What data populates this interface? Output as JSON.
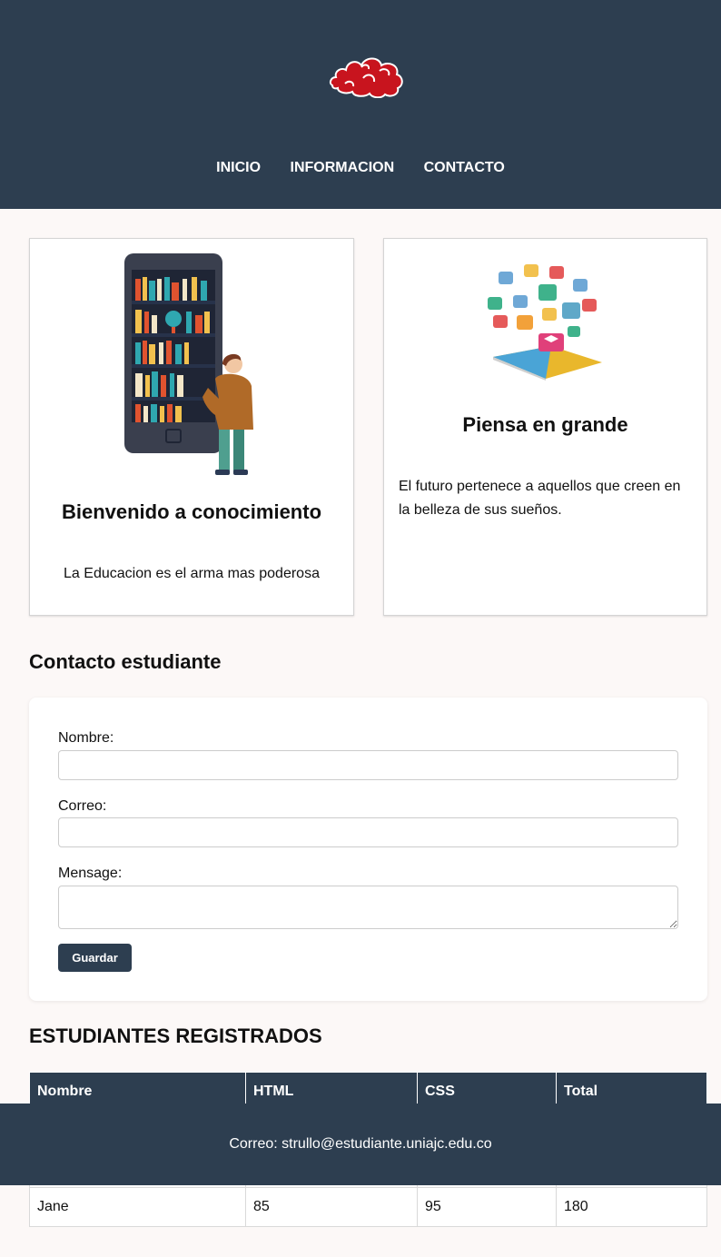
{
  "nav": {
    "items": [
      "INICIO",
      "INFORMACION",
      "CONTACTO"
    ]
  },
  "cards": [
    {
      "title": "Bienvenido a conocimiento",
      "text": "La Educacion es el arma mas poderosa"
    },
    {
      "title": "Piensa en grande",
      "text": "El futuro pertenece a aquellos que creen en la belleza de sus sueños."
    }
  ],
  "contact": {
    "title": "Contacto estudiante",
    "name_label": "Nombre:",
    "email_label": "Correo:",
    "message_label": "Mensage:",
    "name_value": "",
    "email_value": "",
    "message_value": "",
    "save_label": "Guardar"
  },
  "students": {
    "title": "ESTUDIANTES REGISTRADOS",
    "headers": [
      "Nombre",
      "HTML",
      "CSS",
      "Total"
    ],
    "rows": [
      [
        "Jane",
        "85",
        "95",
        "180"
      ]
    ]
  },
  "footer": {
    "text": "Correo: strullo@estudiante.uniajc.edu.co"
  },
  "colors": {
    "primary": "#2d3e50",
    "background": "#fcf8f7",
    "logo": "#c8141e"
  }
}
